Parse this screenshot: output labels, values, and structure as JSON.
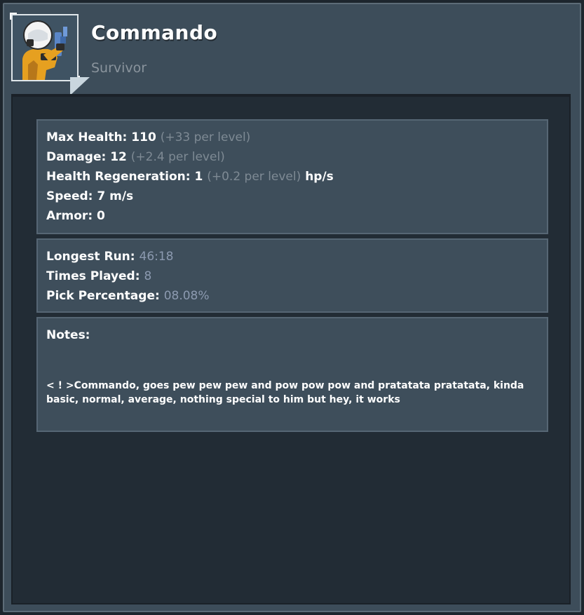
{
  "header": {
    "title": "Commando",
    "subtitle": "Survivor"
  },
  "stats": {
    "max_health_label": "Max Health:",
    "max_health_value": "110",
    "max_health_growth": "(+33 per level)",
    "damage_label": "Damage:",
    "damage_value": "12",
    "damage_growth": "(+2.4 per level)",
    "regen_label": "Health Regeneration:",
    "regen_value": "1",
    "regen_growth": "(+0.2 per level)",
    "regen_unit": "hp/s",
    "speed_label": "Speed:",
    "speed_value": "7 m/s",
    "armor_label": "Armor:",
    "armor_value": "0"
  },
  "records": {
    "longest_run_label": "Longest Run:",
    "longest_run_value": "46:18",
    "times_played_label": "Times Played:",
    "times_played_value": "8",
    "pick_percentage_label": "Pick Percentage:",
    "pick_percentage_value": "08.08%"
  },
  "notes": {
    "label": "Notes:",
    "text": "< ! >Commando, goes pew pew pew and pow pow pow and pratatata pratatata, kinda basic, normal, average, nothing special to him but hey, it works"
  },
  "icons": {
    "portrait": "commando-portrait-icon",
    "arrow": "portrait-corner-arrow-icon"
  },
  "colors": {
    "window_bg": "#3d4d5a",
    "panel_bg": "#222c35",
    "card_bg": "#3e4e5b",
    "muted_text": "#7e8a94",
    "stat_value": "#8c9ab0",
    "commando_suit": "#e6a020"
  }
}
